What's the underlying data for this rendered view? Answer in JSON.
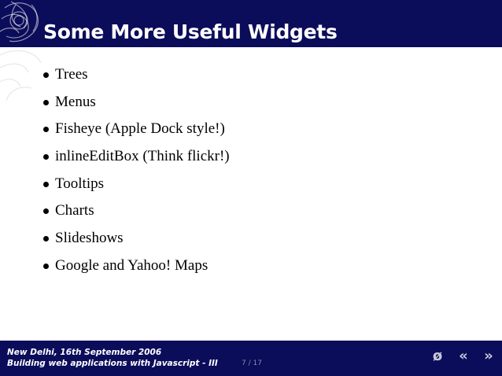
{
  "slide": {
    "title": "Some More Useful Widgets",
    "bullets": [
      "Trees",
      "Menus",
      "Fisheye (Apple Dock style!)",
      "inlineEditBox (Think flickr!)",
      "Tooltips",
      "Charts",
      "Slideshows",
      "Google and Yahoo! Maps"
    ]
  },
  "footer": {
    "line1": "New Delhi, 16th September 2006",
    "line2": "Building web applications with Javascript - III",
    "page_counter": "7 / 17",
    "nav": {
      "toc_symbol": "ø",
      "prev_symbol": "«",
      "next_symbol": "»"
    }
  },
  "colors": {
    "header_background": "#0b0c5a",
    "footer_background": "#0b0c5a",
    "title_text": "#ffffff",
    "body_text": "#000000"
  },
  "icons": [
    "decorative-swirl-logo-icon",
    "toc-icon",
    "previous-icon",
    "next-icon"
  ]
}
